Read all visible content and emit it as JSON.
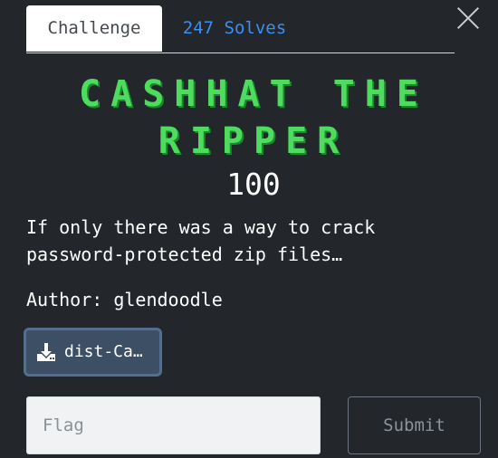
{
  "tabs": {
    "challenge_label": "Challenge",
    "solves_label": "247 Solves"
  },
  "close_icon": "close-icon",
  "challenge": {
    "title": "CASHHAT THE RIPPER",
    "points": "100",
    "description": "If only there was a way to crack password-protected zip files…",
    "author": "Author: glendoodle"
  },
  "file": {
    "label": "dist-Ca…",
    "icon": "download-icon"
  },
  "flag_form": {
    "placeholder": "Flag",
    "submit_label": "Submit"
  },
  "colors": {
    "background": "#23262b",
    "title_green": "#4ddc5e",
    "solves_blue": "#3a8ff2",
    "file_button": "#3c4f64"
  }
}
